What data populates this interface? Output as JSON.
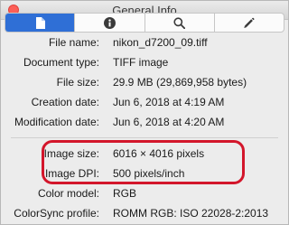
{
  "window": {
    "title": "General Info"
  },
  "tabs": [
    {
      "icon": "document-icon",
      "active": true
    },
    {
      "icon": "info-icon",
      "active": false
    },
    {
      "icon": "magnifier-icon",
      "active": false
    },
    {
      "icon": "pencil-icon",
      "active": false
    }
  ],
  "info": {
    "file_name": {
      "label": "File name:",
      "value": "nikon_d7200_09.tiff"
    },
    "doc_type": {
      "label": "Document type:",
      "value": "TIFF image"
    },
    "file_size": {
      "label": "File size:",
      "value": "29.9 MB (29,869,958 bytes)"
    },
    "created": {
      "label": "Creation date:",
      "value": "Jun 6, 2018 at 4:19 AM"
    },
    "modified": {
      "label": "Modification date:",
      "value": "Jun 6, 2018 at 4:20 AM"
    },
    "image_size": {
      "label": "Image size:",
      "value": "6016 × 4016 pixels"
    },
    "image_dpi": {
      "label": "Image DPI:",
      "value": "500 pixels/inch"
    },
    "color_model": {
      "label": "Color model:",
      "value": "RGB"
    },
    "colorsync": {
      "label": "ColorSync profile:",
      "value": "ROMM RGB: ISO 22028-2:2013"
    }
  },
  "colors": {
    "accent": "#2f6fd6",
    "highlight": "#d3162b"
  }
}
